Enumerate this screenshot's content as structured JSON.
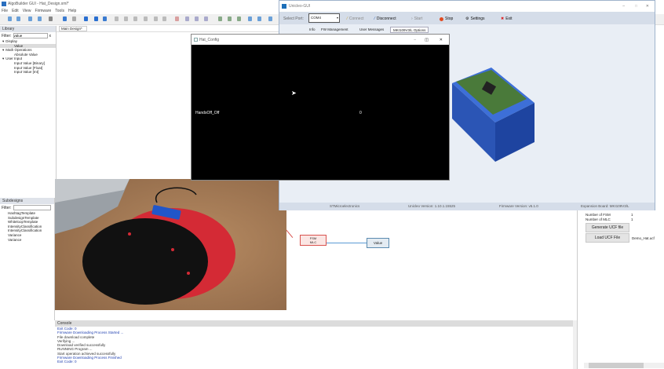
{
  "algo": {
    "title": "AlgoBuilder GUI - Hat_Design.xml*",
    "menu": [
      "File",
      "Edit",
      "View",
      "Firmware",
      "Tools",
      "Help"
    ],
    "tab": "Main Design*",
    "library": {
      "header": "Library",
      "filter_label": "Filter:",
      "filter_value": "value",
      "tree": [
        {
          "label": "Display",
          "level": 0
        },
        {
          "label": "Value",
          "level": 1,
          "selected": true
        },
        {
          "label": "Math Operations",
          "level": 0
        },
        {
          "label": "Absolute Value",
          "level": 1
        },
        {
          "label": "User Input",
          "level": 0
        },
        {
          "label": "Input Value [Binary]",
          "level": 1
        },
        {
          "label": "Input Value [Float]",
          "level": 1
        },
        {
          "label": "Input Value [Int]",
          "level": 1
        }
      ]
    },
    "subdesigns": {
      "header": "Subdesigns",
      "filter_label": "Filter:",
      "filter_value": "",
      "items": [
        "HashtagTemplate",
        "SubdesignTemplate",
        "WhiteloopTemplate",
        "IntensityClassification",
        "IntensityClassification",
        "Variance",
        "Variance"
      ]
    },
    "nodes": {
      "fsm_mlc": [
        "FSM",
        "MLC"
      ],
      "value": "Value"
    },
    "properties": {
      "rows": [
        {
          "label": "Number of FSM",
          "value": "1"
        },
        {
          "label": "Number of MLC",
          "value": "1"
        }
      ],
      "generate_btn": "Generate UCF file",
      "load_btn": "Load UCF File",
      "ucf_file": "Demo_Hat.ucf"
    },
    "console": {
      "header": "Console",
      "lines": [
        {
          "text": "Exit Code: 0",
          "color": "#1f3fb0"
        },
        {
          "text": "Firmware Downloading Process Started ...",
          "color": "#1f3fb0"
        },
        {
          "text": "File download complete",
          "color": "#333333"
        },
        {
          "text": "Verifying ...",
          "color": "#333333"
        },
        {
          "text": "Download verified successfully",
          "color": "#333333"
        },
        {
          "text": "RUNNING Program ...",
          "color": "#333333"
        },
        {
          "text": "Start operation achieved successfully",
          "color": "#333333"
        },
        {
          "text": "Firmware Downloading Process Finished",
          "color": "#1f3fb0"
        },
        {
          "text": "Exit Code: 0",
          "color": "#1f3fb0"
        }
      ]
    }
  },
  "unicleo": {
    "title": "Unicleo-GUI",
    "port_label": "Select Port:",
    "port_value": "COM4",
    "buttons": {
      "connect": "Connect",
      "disconnect": "Disconnect",
      "start": "Start",
      "stop": "Stop",
      "settings": "Settings",
      "exit": "Exit"
    },
    "tabs": [
      "Info",
      "FW Management",
      "User Messages",
      "MKI109V3/L Options"
    ],
    "active_tab": 3,
    "status": {
      "company": "STMicroelectronics",
      "unicleo_version": "Unicleo Version: 1.10.1.15525",
      "firmware_version": "Firmware Version: v5.1.0",
      "expansion_board": "Expansion Board: MKI109V3/L"
    }
  },
  "hat_config": {
    "title": "Hat_Config",
    "label": "HandsOff_Off",
    "value": "0"
  },
  "colors": {
    "accent": "#2a6fbf",
    "node_red": "#d9534f",
    "node_blue": "#5b8bb0",
    "unicleo_toolbar": "#d5dde9"
  }
}
